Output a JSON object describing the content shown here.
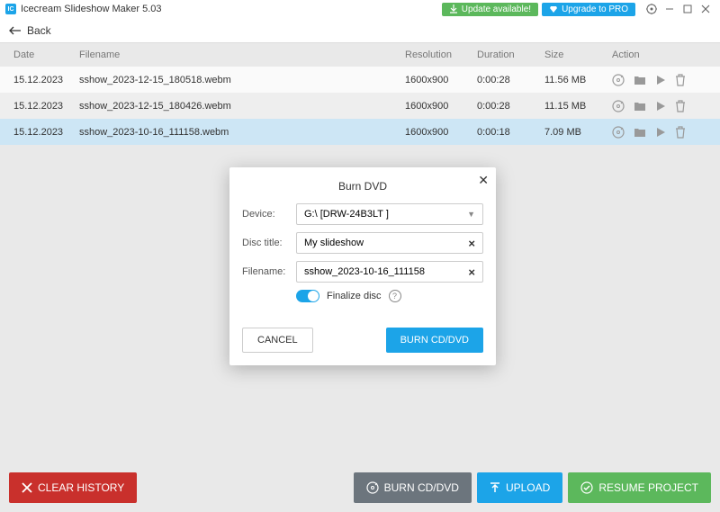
{
  "app": {
    "title": "Icecream Slideshow Maker 5.03"
  },
  "header": {
    "update_label": "Update available!",
    "pro_label": "Upgrade to PRO",
    "back_label": "Back"
  },
  "table": {
    "headers": {
      "date": "Date",
      "filename": "Filename",
      "resolution": "Resolution",
      "duration": "Duration",
      "size": "Size",
      "action": "Action"
    },
    "rows": [
      {
        "date": "15.12.2023",
        "filename": "sshow_2023-12-15_180518.webm",
        "resolution": "1600x900",
        "duration": "0:00:28",
        "size": "11.56 MB"
      },
      {
        "date": "15.12.2023",
        "filename": "sshow_2023-12-15_180426.webm",
        "resolution": "1600x900",
        "duration": "0:00:28",
        "size": "11.15 MB"
      },
      {
        "date": "15.12.2023",
        "filename": "sshow_2023-10-16_111158.webm",
        "resolution": "1600x900",
        "duration": "0:00:18",
        "size": "7.09 MB"
      }
    ]
  },
  "modal": {
    "title": "Burn DVD",
    "device_label": "Device:",
    "device_value": "G:\\ [DRW-24B3LT        ]",
    "disctitle_label": "Disc title:",
    "disctitle_value": "My slideshow",
    "filename_label": "Filename:",
    "filename_value": "sshow_2023-10-16_111158",
    "finalize_label": "Finalize disc",
    "cancel_label": "CANCEL",
    "burn_label": "BURN CD/DVD"
  },
  "footer": {
    "clear_label": "CLEAR HISTORY",
    "burn_label": "BURN CD/DVD",
    "upload_label": "UPLOAD",
    "resume_label": "RESUME PROJECT"
  }
}
